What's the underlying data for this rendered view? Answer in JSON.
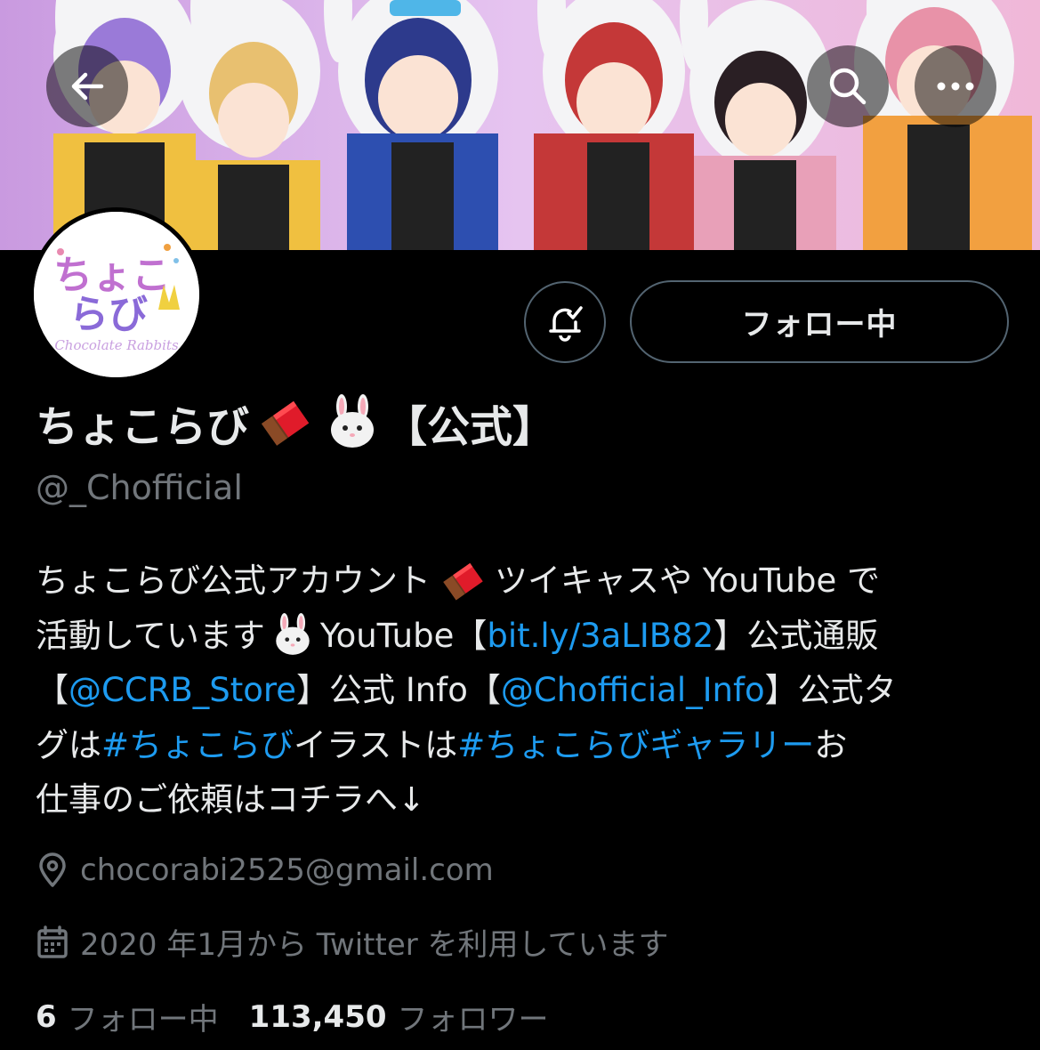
{
  "header": {
    "back_icon": "arrow-left-icon",
    "search_icon": "search-icon",
    "more_icon": "more-icon"
  },
  "banner": {
    "description_colors": [
      "#d8a9e8",
      "#f2f2f2",
      "#f0c040",
      "#2d4fb0",
      "#c43838",
      "#e8a0b8"
    ]
  },
  "avatar": {
    "logo_line1": "ちょこ",
    "logo_line2": "らび",
    "logo_sub": "Chocolate Rabbits"
  },
  "actions": {
    "follow_label": "フォロー中",
    "notify_icon": "bell-check-icon"
  },
  "profile": {
    "display_name": "ちょこらび",
    "name_suffix": "【公式】",
    "handle": "@_Chofficial"
  },
  "bio": {
    "line1": {
      "a": "ちょこらび公式アカウント",
      "b": " ツイキャスや YouTube で"
    },
    "line2": {
      "a": "活動しています",
      "b": " YouTube【",
      "link": "bit.ly/3aLIB82",
      "c": "】公式通販"
    },
    "line3": {
      "a": "【",
      "link1": "@CCRB_Store",
      "b": "】公式 Info【",
      "link2": "@Chofficial_Info",
      "c": "】公式タ"
    },
    "line4": {
      "a": "グは ",
      "link1": "#ちょこらび",
      "b": " イラストは ",
      "link2": "#ちょこらびギャラリー",
      "c": " お"
    },
    "line5": {
      "a": "仕事のご依頼はコチラへ↓"
    }
  },
  "meta": {
    "location": "chocorabi2525@gmail.com",
    "joined": "2020 年1月から Twitter を利用しています"
  },
  "stats": {
    "following_count": "6",
    "following_label": "フォロー中",
    "followers_count": "113,450",
    "followers_label": "フォロワー"
  },
  "colors": {
    "link": "#1d9bf0",
    "muted": "#71767b",
    "text": "#e7e9ea",
    "border": "#536471"
  }
}
